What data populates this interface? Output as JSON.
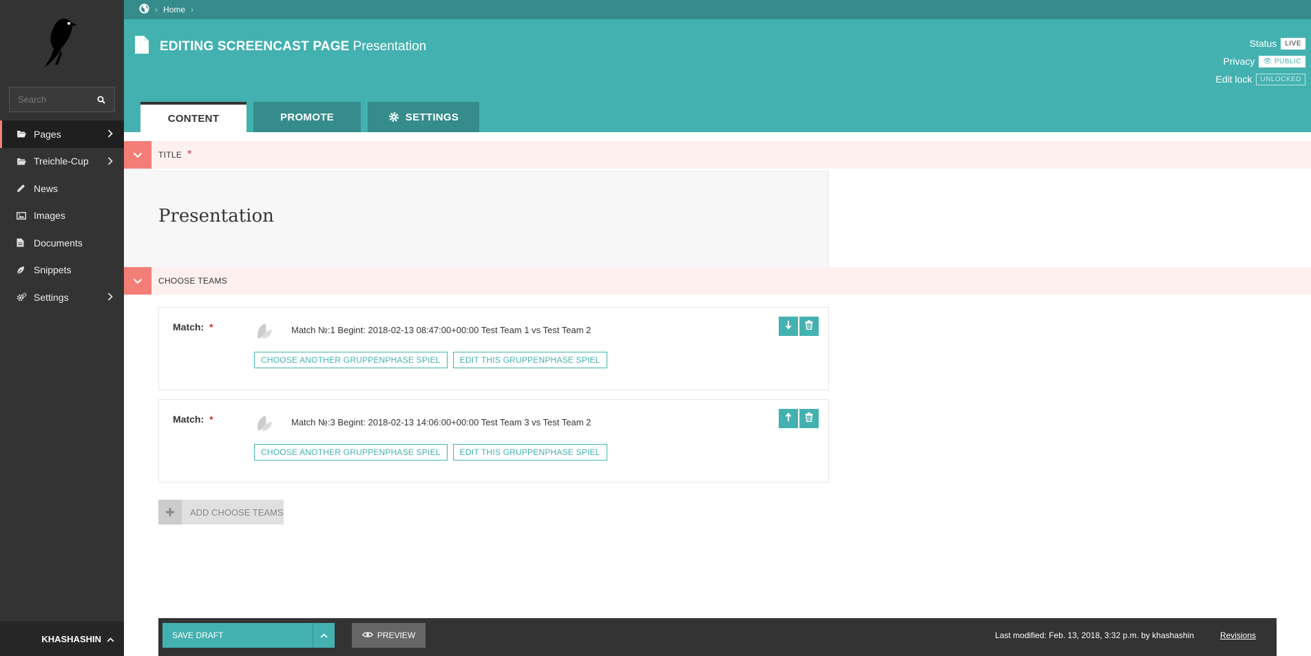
{
  "sidebar": {
    "search_placeholder": "Search",
    "items": [
      {
        "label": "Pages",
        "icon": "folder-open-icon",
        "has_children": true,
        "active": true
      },
      {
        "label": "Treichle-Cup",
        "icon": "folder-open-icon",
        "has_children": true,
        "active": false
      },
      {
        "label": "News",
        "icon": "pencil-icon",
        "has_children": false,
        "active": false
      },
      {
        "label": "Images",
        "icon": "image-icon",
        "has_children": false,
        "active": false
      },
      {
        "label": "Documents",
        "icon": "document-icon",
        "has_children": false,
        "active": false
      },
      {
        "label": "Snippets",
        "icon": "snippet-icon",
        "has_children": false,
        "active": false
      },
      {
        "label": "Settings",
        "icon": "cogs-icon",
        "has_children": true,
        "active": false
      }
    ],
    "user": "KHASHASHIN"
  },
  "header": {
    "breadcrumb_home": "Home",
    "title_bold": "EDITING SCREENCAST PAGE",
    "title_name": "Presentation",
    "status_label": "Status",
    "status_value": "LIVE",
    "privacy_label": "Privacy",
    "privacy_value": "PUBLIC",
    "lock_label": "Edit lock",
    "lock_value": "UNLOCKED",
    "tabs": [
      {
        "label": "CONTENT",
        "active": true
      },
      {
        "label": "PROMOTE",
        "active": false
      },
      {
        "label": "SETTINGS",
        "active": false
      }
    ]
  },
  "content": {
    "title_section_label": "TITLE",
    "title_value": "Presentation",
    "teams_section_label": "CHOOSE TEAMS",
    "matches": [
      {
        "label": "Match:",
        "text": "Match №:1 Begint: 2018-02-13 08:47:00+00:00 Test Team 1 vs Test Team 2",
        "choose_label": "CHOOSE ANOTHER GRUPPENPHASE SPIEL",
        "edit_label": "EDIT THIS GRUPPENPHASE SPIEL",
        "move": "down"
      },
      {
        "label": "Match:",
        "text": "Match №:3 Begint: 2018-02-13 14:06:00+00:00 Test Team 3 vs Test Team 2",
        "choose_label": "CHOOSE ANOTHER GRUPPENPHASE SPIEL",
        "edit_label": "EDIT THIS GRUPPENPHASE SPIEL",
        "move": "up"
      }
    ],
    "add_label": "ADD CHOOSE TEAMS"
  },
  "footer": {
    "save_label": "SAVE DRAFT",
    "preview_label": "PREVIEW",
    "last_modified": "Last modified: Feb. 13, 2018, 3:32 p.m. by khashashin",
    "revisions_label": "Revisions"
  },
  "colors": {
    "accent": "#43b1b0",
    "accent_dark": "#358c8b",
    "sidebar": "#333333",
    "error": "#f37e77"
  }
}
